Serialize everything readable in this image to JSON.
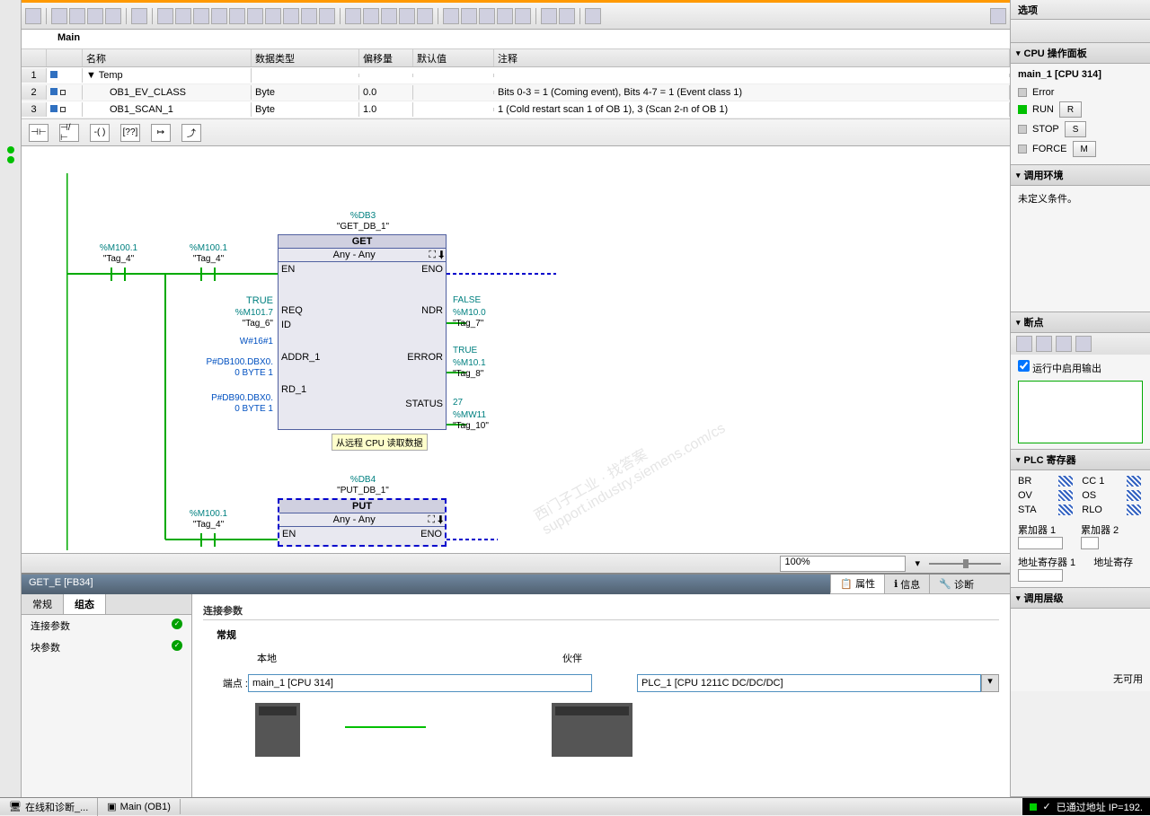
{
  "main_title": "Main",
  "grid": {
    "headers": [
      "",
      "",
      "名称",
      "数据类型",
      "偏移量",
      "默认值",
      "注释"
    ],
    "rows": [
      {
        "n": "1",
        "name": "▼  Temp",
        "type": "",
        "off": "",
        "def": "",
        "comment": ""
      },
      {
        "n": "2",
        "name": "OB1_EV_CLASS",
        "type": "Byte",
        "off": "0.0",
        "def": "",
        "comment": "Bits 0-3 = 1 (Coming event), Bits 4-7 = 1 (Event class 1)"
      },
      {
        "n": "3",
        "name": "OB1_SCAN_1",
        "type": "Byte",
        "off": "1.0",
        "def": "",
        "comment": "1 (Cold restart scan 1 of OB 1), 3 (Scan 2-n of OB 1)"
      }
    ]
  },
  "network": {
    "db1": {
      "addr": "%DB3",
      "name": "\"GET_DB_1\""
    },
    "fb1": {
      "title": "GET",
      "sub": "Any  -  Any",
      "tooltip": "从远程 CPU 读取数据",
      "left": [
        {
          "pin": "EN"
        },
        {
          "pin": "REQ",
          "val": "TRUE",
          "addr": "%M101.7",
          "tag": "\"Tag_6\""
        },
        {
          "pin": "ID",
          "val": "W#16#1"
        },
        {
          "pin": "ADDR_1",
          "val": "P#DB100.DBX0.",
          "val2": "0 BYTE 1"
        },
        {
          "pin": "RD_1",
          "val": "P#DB90.DBX0.",
          "val2": "0 BYTE 1"
        }
      ],
      "right": [
        {
          "pin": "ENO"
        },
        {
          "pin": "NDR",
          "val": "FALSE",
          "addr": "%M10.0",
          "tag": "\"Tag_7\""
        },
        {
          "pin": "ERROR",
          "val": "TRUE",
          "addr": "%M10.1",
          "tag": "\"Tag_8\""
        },
        {
          "pin": "STATUS",
          "val": "27",
          "addr": "%MW11",
          "tag": "\"Tag_10\""
        }
      ]
    },
    "contact1": {
      "addr": "%M100.1",
      "tag": "\"Tag_4\""
    },
    "contact2": {
      "addr": "%M100.1",
      "tag": "\"Tag_4\""
    },
    "db2": {
      "addr": "%DB4",
      "name": "\"PUT_DB_1\""
    },
    "fb2": {
      "title": "PUT",
      "sub": "Any  -  Any",
      "left": [
        {
          "pin": "EN"
        }
      ],
      "right": [
        {
          "pin": "ENO"
        }
      ]
    },
    "contact3": {
      "addr": "%M100.1",
      "tag": "\"Tag_4\""
    }
  },
  "zoom": "100%",
  "props": {
    "title": "GET_E [FB34]",
    "top_tabs": [
      "属性",
      "信息",
      "诊断"
    ],
    "nav_tabs": [
      "常规",
      "组态"
    ],
    "nav_items": [
      "连接参数",
      "块参数"
    ],
    "section": "连接参数",
    "subsection": "常规",
    "local_lbl": "本地",
    "partner_lbl": "伙伴",
    "endpoint_lbl": "端点 :",
    "local_ep": "main_1 [CPU 314]",
    "partner_ep": "PLC_1 [CPU 1211C DC/DC/DC]"
  },
  "right_panel": {
    "options": "选项",
    "cpu_panel": "CPU 操作面板",
    "cpu_name": "main_1 [CPU 314]",
    "error": "Error",
    "run": "RUN",
    "stop": "STOP",
    "force": "FORCE",
    "btn_r": "R",
    "btn_s": "S",
    "btn_m": "M",
    "env": "调用环境",
    "env_txt": "未定义条件。",
    "bp": "断点",
    "bp_chk": "运行中启用输出",
    "reg": "PLC 寄存器",
    "regs": {
      "BR": "BR",
      "CC1": "CC 1",
      "OV": "OV",
      "OS": "OS",
      "STA": "STA",
      "RLO": "RLO"
    },
    "acc1": "累加器 1",
    "acc2": "累加器 2",
    "ar1": "地址寄存器 1",
    "ar2": "地址寄存",
    "call": "调用层级",
    "na": "无可用"
  },
  "statusbar": {
    "monitor": "在线和诊断_...",
    "mainob": "Main (OB1)",
    "conn": "已通过地址 IP=192."
  }
}
